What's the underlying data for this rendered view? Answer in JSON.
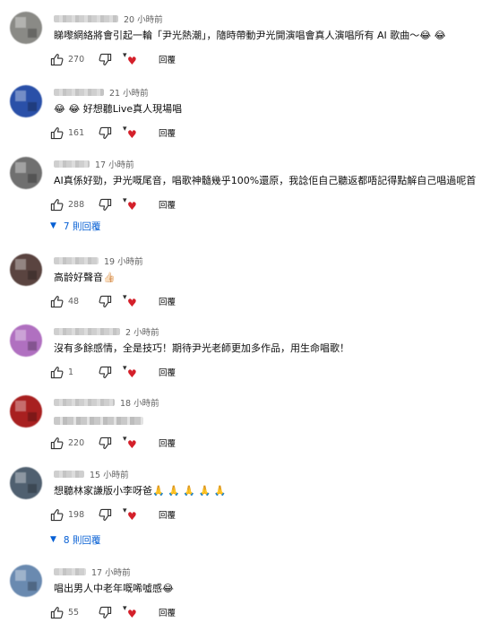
{
  "colors": {
    "link": "#065fd4",
    "heart": "#d4202a",
    "secondary": "#606060"
  },
  "icons": {
    "like": "thumb-up-icon",
    "dislike": "thumb-down-icon",
    "heart": "creator-heart-icon",
    "chevron": "chevron-down-icon"
  },
  "labels": {
    "reply": "回覆"
  },
  "comments": [
    {
      "time": "20 小時前",
      "text": "睇嚟網絡將會引起一輪「尹光熱潮」，隨時帶動尹光開演唱會真人演唱所有 AI 歌曲～😂 😂",
      "likes": "270",
      "avatar_color": "#8a8a86"
    },
    {
      "time": "21 小時前",
      "text": "😂 😂 好想聽Live真人現場唱",
      "likes": "161",
      "avatar_color": "#2a50a8"
    },
    {
      "time": "17 小時前",
      "text": "AI真係好勁，尹光嘅尾音，唱歌神髓幾乎100%還原，我諗佢自己聽返都唔記得點解自己唱過呢首",
      "likes": "288",
      "avatar_color": "#707070",
      "replies": "7 則回覆"
    },
    {
      "time": "19 小時前",
      "text": "高龄好聲音👍🏻",
      "likes": "48",
      "avatar_color": "#5a4440"
    },
    {
      "time": "2 小時前",
      "text": "沒有多餘感情，全是技巧！期待尹光老師更加多作品，用生命唱歌！",
      "likes": "1",
      "avatar_color": "#b070c0"
    },
    {
      "time": "18 小時前",
      "text": "",
      "likes": "220",
      "avatar_color": "#a82020"
    },
    {
      "time": "15 小時前",
      "text": "想聽林家謙版小李呀爸🙏 🙏 🙏 🙏 🙏",
      "likes": "198",
      "avatar_color": "#506070",
      "replies": "8 則回覆"
    },
    {
      "time": "17 小時前",
      "text": "唱出男人中老年嘅唏噓感😂",
      "likes": "55",
      "avatar_color": "#6a8ab0"
    }
  ]
}
